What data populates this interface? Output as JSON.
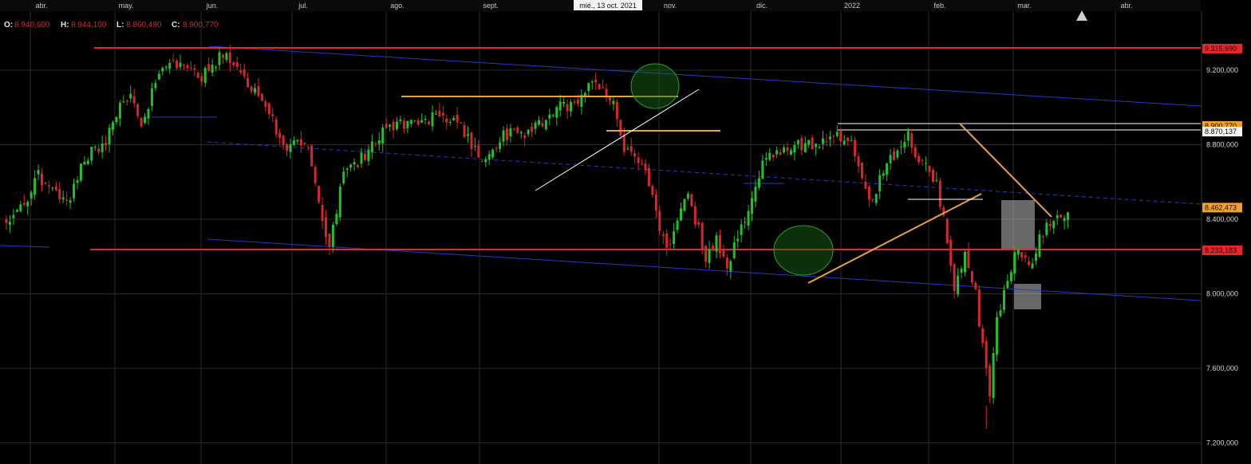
{
  "ohlc": {
    "o_key": "O:",
    "o_val": "8.940,600",
    "h_key": "H:",
    "h_val": "8.944,100",
    "l_key": "L:",
    "l_val": "8.860,490",
    "c_key": "C:",
    "c_val": "8.900,770"
  },
  "crosshair_label": "mié., 13 oct. 2021",
  "months": [
    "abr.",
    "may.",
    "jun.",
    "jul.",
    "ago.",
    "sept.",
    "oct.",
    "nov.",
    "dic.",
    "2022",
    "feb.",
    "mar.",
    "abr."
  ],
  "colors": {
    "background": "#000000",
    "grid": "#2a2a2a",
    "up": "#22c02c",
    "down": "#d8262a",
    "red_line": "#e8262a",
    "orange": "#e8a040",
    "blue": "#2838c8",
    "white": "#ffffff",
    "circle": "#1a6a1a"
  },
  "chart_data": {
    "type": "candlestick",
    "x_axis": {
      "ticks": [
        "abr.",
        "may.",
        "jun.",
        "jul.",
        "ago.",
        "sept.",
        "nov.",
        "dic.",
        "2022",
        "feb.",
        "mar.",
        "abr."
      ]
    },
    "y_axis": {
      "ticks": [
        "9.200,000",
        "8.800,000",
        "8.400,000",
        "8.000,000",
        "7.600,000",
        "7.200,000"
      ],
      "range": [
        7150,
        9450
      ]
    },
    "price_levels": [
      {
        "value": 9315.69,
        "label": "9.315,690",
        "style": "red-box"
      },
      {
        "value": 8900.77,
        "label": "8.900,770",
        "style": "orange-box"
      },
      {
        "value": 8870.137,
        "label": "8.870,137",
        "style": "white-box"
      },
      {
        "value": 8462.473,
        "label": "8.462,473",
        "style": "orange-box"
      },
      {
        "value": 8233.183,
        "label": "8.233,183",
        "style": "red-box"
      }
    ],
    "anchors": [
      [
        0,
        8380
      ],
      [
        5,
        8480
      ],
      [
        9,
        8630
      ],
      [
        13,
        8540
      ],
      [
        18,
        8520
      ],
      [
        22,
        8740
      ],
      [
        27,
        8780
      ],
      [
        32,
        9020
      ],
      [
        35,
        9070
      ],
      [
        38,
        8930
      ],
      [
        44,
        9210
      ],
      [
        49,
        9250
      ],
      [
        54,
        9150
      ],
      [
        58,
        9220
      ],
      [
        61,
        9300
      ],
      [
        65,
        9230
      ],
      [
        69,
        9100
      ],
      [
        73,
        8980
      ],
      [
        79,
        8800
      ],
      [
        85,
        8800
      ],
      [
        88,
        8460
      ],
      [
        91,
        8250
      ],
      [
        95,
        8640
      ],
      [
        100,
        8730
      ],
      [
        108,
        8900
      ],
      [
        115,
        8920
      ],
      [
        122,
        8960
      ],
      [
        127,
        8930
      ],
      [
        134,
        8720
      ],
      [
        140,
        8850
      ],
      [
        145,
        8860
      ],
      [
        150,
        8900
      ],
      [
        155,
        8990
      ],
      [
        160,
        9030
      ],
      [
        165,
        9140
      ],
      [
        171,
        9020
      ],
      [
        174,
        8780
      ],
      [
        180,
        8640
      ],
      [
        186,
        8220
      ],
      [
        192,
        8540
      ],
      [
        197,
        8200
      ],
      [
        200,
        8290
      ],
      [
        203,
        8150
      ],
      [
        208,
        8400
      ],
      [
        213,
        8700
      ],
      [
        220,
        8800
      ],
      [
        228,
        8800
      ],
      [
        233,
        8850
      ],
      [
        238,
        8800
      ],
      [
        243,
        8480
      ],
      [
        248,
        8700
      ],
      [
        254,
        8850
      ],
      [
        257,
        8720
      ],
      [
        262,
        8600
      ],
      [
        264,
        8400
      ],
      [
        267,
        8020
      ],
      [
        270,
        8230
      ],
      [
        273,
        8000
      ],
      [
        275,
        7700
      ],
      [
        277,
        7450
      ],
      [
        279,
        7850
      ],
      [
        282,
        8100
      ],
      [
        285,
        8250
      ],
      [
        288,
        8120
      ],
      [
        291,
        8300
      ],
      [
        295,
        8420
      ],
      [
        299,
        8430
      ]
    ]
  }
}
